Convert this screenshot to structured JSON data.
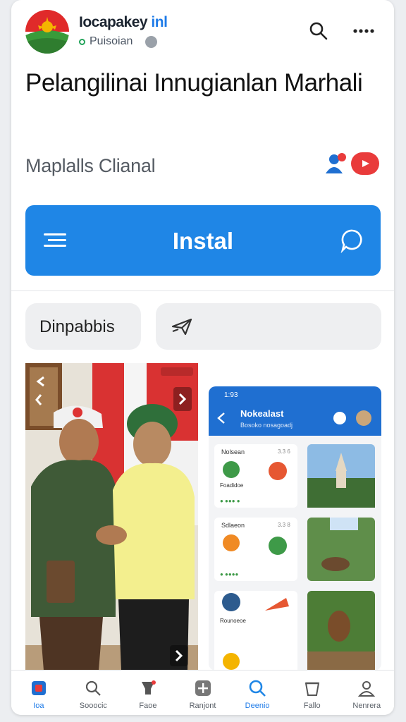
{
  "header": {
    "app_name_prefix": "Iocapakey",
    "app_name_accent": "inl",
    "publisher": "Puisoian"
  },
  "title": "Pelangilinai Innugianlan Marhali",
  "subtitle": "Maplalls Clianal",
  "install": {
    "label": "Instal"
  },
  "chips": [
    {
      "label": "Dinpabbis"
    },
    {
      "label": ""
    }
  ],
  "screenshot2": {
    "status_time": "1:93",
    "title": "Nokealast",
    "subtitle": "Bosoko nosagoadj",
    "cards": [
      {
        "title": "Nolsean",
        "meta": "3.3 6",
        "footer": "Foadidoe",
        "caption": "● ●●● ●"
      },
      {
        "title": "Sdlaeon",
        "meta": "3.3 8",
        "footer": "● ●●●●",
        "caption": ""
      },
      {
        "title": "",
        "meta": "",
        "footer": "Rounoeoe",
        "caption": ""
      }
    ]
  },
  "nav": [
    {
      "label": "Ioa",
      "icon": "home-icon",
      "active": true
    },
    {
      "label": "Sooocic",
      "icon": "search-icon",
      "active": false
    },
    {
      "label": "Faoe",
      "icon": "games-icon",
      "active": false
    },
    {
      "label": "Ranjont",
      "icon": "plus-icon",
      "active": false
    },
    {
      "label": "Deenio",
      "icon": "explore-icon",
      "active": true
    },
    {
      "label": "Fallo",
      "icon": "bucket-icon",
      "active": false
    },
    {
      "label": "Nenrera",
      "icon": "profile-icon",
      "active": false
    }
  ],
  "colors": {
    "accent": "#1f86e6",
    "badge_red": "#e93b3b"
  }
}
